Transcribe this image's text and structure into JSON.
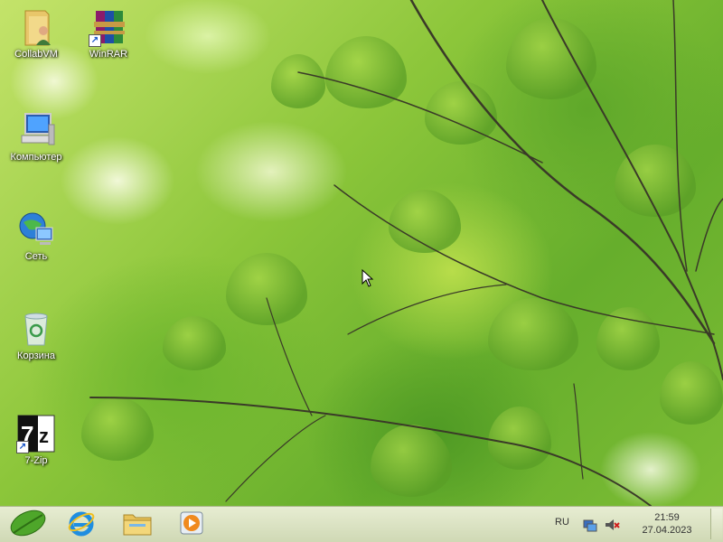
{
  "desktop": {
    "icons": [
      {
        "label": "CollabVM",
        "icon": "folder-user-icon"
      },
      {
        "label": "WinRAR",
        "icon": "winrar-icon"
      },
      {
        "label": "Компьютер",
        "icon": "computer-icon"
      },
      {
        "label": "Сеть",
        "icon": "network-icon"
      },
      {
        "label": "Корзина",
        "icon": "recycle-bin-icon"
      },
      {
        "label": "7-Zip",
        "icon": "7zip-icon"
      }
    ]
  },
  "taskbar": {
    "start_icon": "start-leaf-icon",
    "pinned": [
      {
        "name": "internet-explorer",
        "icon": "ie-icon"
      },
      {
        "name": "file-explorer",
        "icon": "explorer-folder-icon"
      },
      {
        "name": "media-player",
        "icon": "media-player-icon"
      }
    ],
    "language": "RU",
    "clock_time": "21:59",
    "clock_date": "27.04.2023"
  },
  "colors": {
    "taskbar_bg": "#dde4c4",
    "wallpaper_green": "#7dbd35"
  }
}
